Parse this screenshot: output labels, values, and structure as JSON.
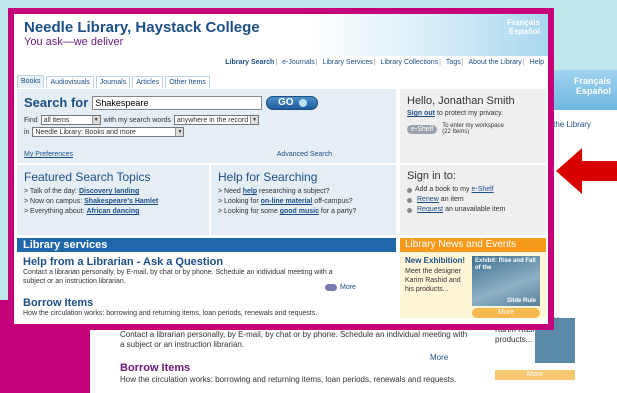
{
  "header": {
    "title": "Needle Library, Haystack College",
    "tagline": "You ask—we deliver",
    "languages": [
      "Français",
      "Español"
    ]
  },
  "topnav": [
    "Library Search",
    "e-Journals",
    "Library Services",
    "Library Collections",
    "Tags",
    "About the Library",
    "Help"
  ],
  "tabs": [
    "Books",
    "Audiovisuals",
    "Journals",
    "Articles",
    "Other Items"
  ],
  "search": {
    "label": "Search for",
    "value": "Shakespeare",
    "go": "GO",
    "find_label": "Find",
    "find_select": "all items",
    "with_label": "with my search words",
    "scope_select": "anywhere in the record",
    "in_label": "in",
    "collection_select": "Needle Library: Books and more",
    "preferences": "My Preferences",
    "advanced": "Advanced Search"
  },
  "featured": {
    "title": "Featured Search Topics",
    "items": [
      {
        "prefix": "> Talk of the day: ",
        "link": "Discovery landing"
      },
      {
        "prefix": "> Now on campus: ",
        "link": "Shakespeare's Hamlet"
      },
      {
        "prefix": "> Everything about: ",
        "link": "African dancing"
      }
    ]
  },
  "help": {
    "title": "Help for Searching",
    "items": [
      {
        "prefix": "> Need ",
        "link": "help",
        "suffix": " researching a subject?"
      },
      {
        "prefix": "> Looking for ",
        "link": "on-line material",
        "suffix": " off-campus?"
      },
      {
        "prefix": "> Looking for some ",
        "link": "good music",
        "suffix": " for a party?"
      }
    ]
  },
  "user": {
    "greeting": "Hello, Jonathan Smith",
    "signout": "Sign out",
    "signout_suffix": " to protect my privacy.",
    "eshelf": "e-Shelf",
    "eshelf_text": "To enter my workspace (22 Items)"
  },
  "signin": {
    "title": "Sign in to:",
    "items": [
      {
        "prefix": "Add a book to my ",
        "link": "e-Shelf",
        "suffix": ""
      },
      {
        "prefix": "",
        "link": "Renew",
        "suffix": " an item"
      },
      {
        "prefix": "",
        "link": "Request",
        "suffix": " an unavailable item"
      }
    ]
  },
  "services": {
    "title": "Library services",
    "items": [
      {
        "title": "Help from a Librarian - Ask a Question",
        "text": "Contact a librarian personally, by E-mail, by chat or by phone. Schedule an individual meeting with a subject or an instruction librarian."
      },
      {
        "title": "Borrow Items",
        "text": "How the circulation works: borrowing and returning items, loan periods, renewals and requests."
      }
    ],
    "more": "More"
  },
  "news": {
    "title": "Library News and Events",
    "headline": "New Exhibition!",
    "text": "Meet the designer Karim Rashid and his products...",
    "image_caption": "Exhibit: Rise and Fall of the",
    "image_caption2": "Slide Rule",
    "more": "More"
  },
  "colors": {
    "frame": "#c4007a",
    "brand_blue": "#1c4f86",
    "news_orange": "#f79a1b",
    "arrow_red": "#d90000"
  }
}
